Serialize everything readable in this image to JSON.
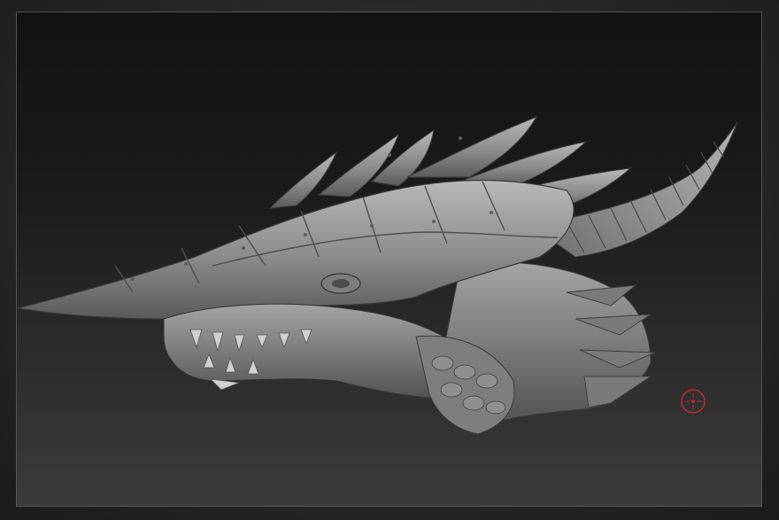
{
  "viewport": {
    "background_top": "#121212",
    "background_bottom": "#3b3b3b",
    "frame_color": "#555555"
  },
  "model": {
    "icon": "dragon-head-sculpt",
    "material_base": "#8a8a8a",
    "material_highlight": "#bdbdbd",
    "material_shadow": "#4a4a4a"
  },
  "gizmo": {
    "icon": "pivot-crosshair-icon",
    "color": "#c02a2a"
  }
}
